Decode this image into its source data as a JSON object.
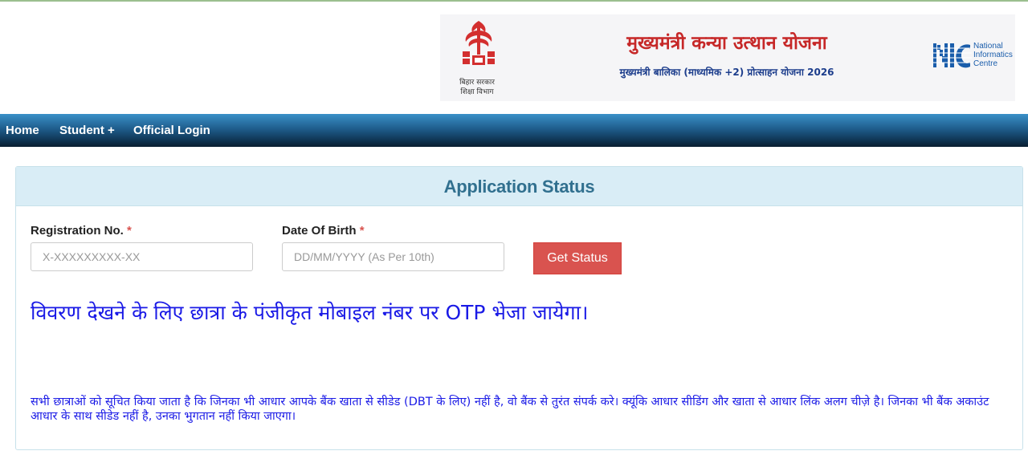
{
  "header": {
    "emblem_caption_line1": "बिहार सरकार",
    "emblem_caption_line2": "शिक्षा विभाग",
    "title_main": "मुख्यमंत्री कन्या उत्थान योजना",
    "title_sub": "मुख्यमंत्री बालिका (माध्यमिक +2) प्रोत्साहन योजना 2026",
    "nic_line1": "National",
    "nic_line2": "Informatics",
    "nic_line3": "Centre",
    "icons": {
      "emblem": "bihar-emblem-icon",
      "nic": "nic-logo-icon"
    }
  },
  "nav": {
    "items": [
      {
        "label": "Home"
      },
      {
        "label": "Student +"
      },
      {
        "label": "Official Login"
      }
    ]
  },
  "panel": {
    "title": "Application Status",
    "registration": {
      "label": "Registration No.",
      "required_mark": "*",
      "placeholder": "X-XXXXXXXXX-XX",
      "value": ""
    },
    "dob": {
      "label": "Date Of Birth",
      "required_mark": "*",
      "placeholder": "DD/MM/YYYY (As Per 10th)",
      "value": ""
    },
    "button_label": "Get Status",
    "otp_note": "विवरण देखने के लिए छात्रा के पंजीकृत मोबाइल नंबर पर OTP भेजा जायेगा।",
    "dbt_note": "सभी छात्राओं को सूचित किया जाता है कि जिनका भी आधार आपके बैंक खाता से सीडेड (DBT के लिए) नहीं है, वो बैंक से तुरंत संपर्क करे। क्यूंकि आधार सीडिंग और खाता से आधार लिंक अलग चीज़े है। जिनका भी बैंक अकाउंट आधार के साथ सीडेड नहीं है, उनका भुगतान नहीं किया जाएगा।"
  },
  "colors": {
    "title_red": "#c62828",
    "subtitle_blue": "#1c3d8c",
    "panel_heading_bg": "#d9edf6",
    "panel_heading_text": "#31708f",
    "button_red": "#d9534f",
    "notice_blue": "#1a1ae6",
    "nav_dark": "#0d2f4a"
  }
}
